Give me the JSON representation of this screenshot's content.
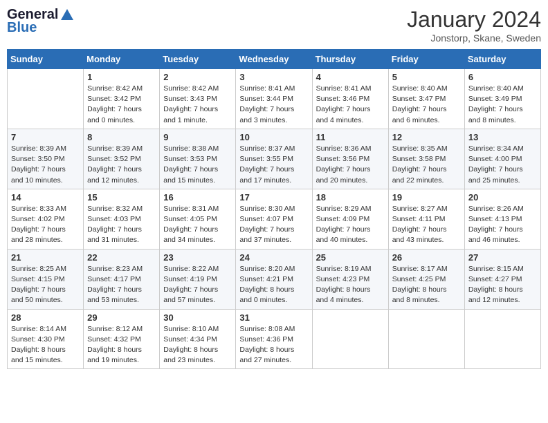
{
  "logo": {
    "general": "General",
    "blue": "Blue"
  },
  "title": "January 2024",
  "location": "Jonstorp, Skane, Sweden",
  "days_of_week": [
    "Sunday",
    "Monday",
    "Tuesday",
    "Wednesday",
    "Thursday",
    "Friday",
    "Saturday"
  ],
  "weeks": [
    [
      {
        "day": "",
        "info": ""
      },
      {
        "day": "1",
        "info": "Sunrise: 8:42 AM\nSunset: 3:42 PM\nDaylight: 7 hours\nand 0 minutes."
      },
      {
        "day": "2",
        "info": "Sunrise: 8:42 AM\nSunset: 3:43 PM\nDaylight: 7 hours\nand 1 minute."
      },
      {
        "day": "3",
        "info": "Sunrise: 8:41 AM\nSunset: 3:44 PM\nDaylight: 7 hours\nand 3 minutes."
      },
      {
        "day": "4",
        "info": "Sunrise: 8:41 AM\nSunset: 3:46 PM\nDaylight: 7 hours\nand 4 minutes."
      },
      {
        "day": "5",
        "info": "Sunrise: 8:40 AM\nSunset: 3:47 PM\nDaylight: 7 hours\nand 6 minutes."
      },
      {
        "day": "6",
        "info": "Sunrise: 8:40 AM\nSunset: 3:49 PM\nDaylight: 7 hours\nand 8 minutes."
      }
    ],
    [
      {
        "day": "7",
        "info": ""
      },
      {
        "day": "8",
        "info": "Sunrise: 8:39 AM\nSunset: 3:52 PM\nDaylight: 7 hours\nand 12 minutes."
      },
      {
        "day": "9",
        "info": "Sunrise: 8:38 AM\nSunset: 3:53 PM\nDaylight: 7 hours\nand 15 minutes."
      },
      {
        "day": "10",
        "info": "Sunrise: 8:37 AM\nSunset: 3:55 PM\nDaylight: 7 hours\nand 17 minutes."
      },
      {
        "day": "11",
        "info": "Sunrise: 8:36 AM\nSunset: 3:56 PM\nDaylight: 7 hours\nand 20 minutes."
      },
      {
        "day": "12",
        "info": "Sunrise: 8:35 AM\nSunset: 3:58 PM\nDaylight: 7 hours\nand 22 minutes."
      },
      {
        "day": "13",
        "info": "Sunrise: 8:34 AM\nSunset: 4:00 PM\nDaylight: 7 hours\nand 25 minutes."
      }
    ],
    [
      {
        "day": "14",
        "info": ""
      },
      {
        "day": "15",
        "info": "Sunrise: 8:32 AM\nSunset: 4:03 PM\nDaylight: 7 hours\nand 31 minutes."
      },
      {
        "day": "16",
        "info": "Sunrise: 8:31 AM\nSunset: 4:05 PM\nDaylight: 7 hours\nand 34 minutes."
      },
      {
        "day": "17",
        "info": "Sunrise: 8:30 AM\nSunset: 4:07 PM\nDaylight: 7 hours\nand 37 minutes."
      },
      {
        "day": "18",
        "info": "Sunrise: 8:29 AM\nSunset: 4:09 PM\nDaylight: 7 hours\nand 40 minutes."
      },
      {
        "day": "19",
        "info": "Sunrise: 8:27 AM\nSunset: 4:11 PM\nDaylight: 7 hours\nand 43 minutes."
      },
      {
        "day": "20",
        "info": "Sunrise: 8:26 AM\nSunset: 4:13 PM\nDaylight: 7 hours\nand 46 minutes."
      }
    ],
    [
      {
        "day": "21",
        "info": ""
      },
      {
        "day": "22",
        "info": "Sunrise: 8:23 AM\nSunset: 4:17 PM\nDaylight: 7 hours\nand 53 minutes."
      },
      {
        "day": "23",
        "info": "Sunrise: 8:22 AM\nSunset: 4:19 PM\nDaylight: 7 hours\nand 57 minutes."
      },
      {
        "day": "24",
        "info": "Sunrise: 8:20 AM\nSunset: 4:21 PM\nDaylight: 8 hours\nand 0 minutes."
      },
      {
        "day": "25",
        "info": "Sunrise: 8:19 AM\nSunset: 4:23 PM\nDaylight: 8 hours\nand 4 minutes."
      },
      {
        "day": "26",
        "info": "Sunrise: 8:17 AM\nSunset: 4:25 PM\nDaylight: 8 hours\nand 8 minutes."
      },
      {
        "day": "27",
        "info": "Sunrise: 8:15 AM\nSunset: 4:27 PM\nDaylight: 8 hours\nand 12 minutes."
      }
    ],
    [
      {
        "day": "28",
        "info": ""
      },
      {
        "day": "29",
        "info": "Sunrise: 8:12 AM\nSunset: 4:32 PM\nDaylight: 8 hours\nand 19 minutes."
      },
      {
        "day": "30",
        "info": "Sunrise: 8:10 AM\nSunset: 4:34 PM\nDaylight: 8 hours\nand 23 minutes."
      },
      {
        "day": "31",
        "info": "Sunrise: 8:08 AM\nSunset: 4:36 PM\nDaylight: 8 hours\nand 27 minutes."
      },
      {
        "day": "",
        "info": ""
      },
      {
        "day": "",
        "info": ""
      },
      {
        "day": "",
        "info": ""
      }
    ]
  ],
  "week1_sunday_info": "Sunrise: 8:39 AM\nSunset: 3:50 PM\nDaylight: 7 hours\nand 10 minutes.",
  "week2_sunday_info": "Sunrise: 8:33 AM\nSunset: 4:02 PM\nDaylight: 7 hours\nand 28 minutes.",
  "week3_sunday_info": "Sunrise: 8:25 AM\nSunset: 4:15 PM\nDaylight: 7 hours\nand 50 minutes.",
  "week4_sunday_info": "Sunrise: 8:14 AM\nSunset: 4:30 PM\nDaylight: 8 hours\nand 15 minutes."
}
